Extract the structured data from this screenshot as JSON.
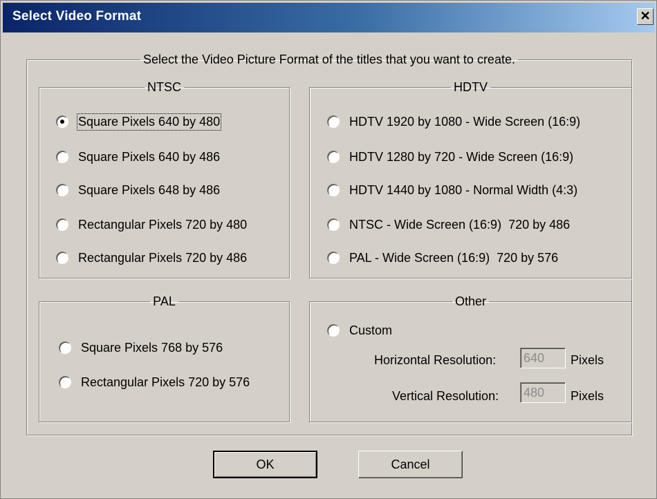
{
  "window": {
    "title": "Select Video Format",
    "close_glyph": "✕",
    "close_icon": "close-icon"
  },
  "outer": {
    "legend": "Select the Video Picture Format of the titles that you want to create."
  },
  "ntsc": {
    "legend": "NTSC",
    "options": [
      {
        "label": "Square Pixels 640 by 480",
        "selected": true
      },
      {
        "label": "Square Pixels 640 by 486",
        "selected": false
      },
      {
        "label": "Square Pixels 648 by 486",
        "selected": false
      },
      {
        "label": "Rectangular Pixels 720 by 480",
        "selected": false
      },
      {
        "label": "Rectangular Pixels 720 by 486",
        "selected": false
      }
    ]
  },
  "hdtv": {
    "legend": "HDTV",
    "options": [
      {
        "label": "HDTV 1920 by 1080 - Wide Screen (16:9)",
        "selected": false
      },
      {
        "label": "HDTV 1280 by 720 - Wide Screen (16:9)",
        "selected": false
      },
      {
        "label": "HDTV 1440 by 1080 - Normal Width (4:3)",
        "selected": false
      },
      {
        "label": "NTSC - Wide Screen (16:9)  720 by 486",
        "selected": false
      },
      {
        "label": "PAL - Wide Screen (16:9)  720 by 576",
        "selected": false
      }
    ]
  },
  "pal": {
    "legend": "PAL",
    "options": [
      {
        "label": "Square Pixels 768 by 576",
        "selected": false
      },
      {
        "label": "Rectangular Pixels 720 by 576",
        "selected": false
      }
    ]
  },
  "other": {
    "legend": "Other",
    "custom_label": "Custom",
    "custom_selected": false,
    "horizontal_label": "Horizontal Resolution:",
    "horizontal_value": "640",
    "vertical_label": "Vertical Resolution:",
    "vertical_value": "480",
    "unit": "Pixels"
  },
  "buttons": {
    "ok": "OK",
    "cancel": "Cancel"
  }
}
